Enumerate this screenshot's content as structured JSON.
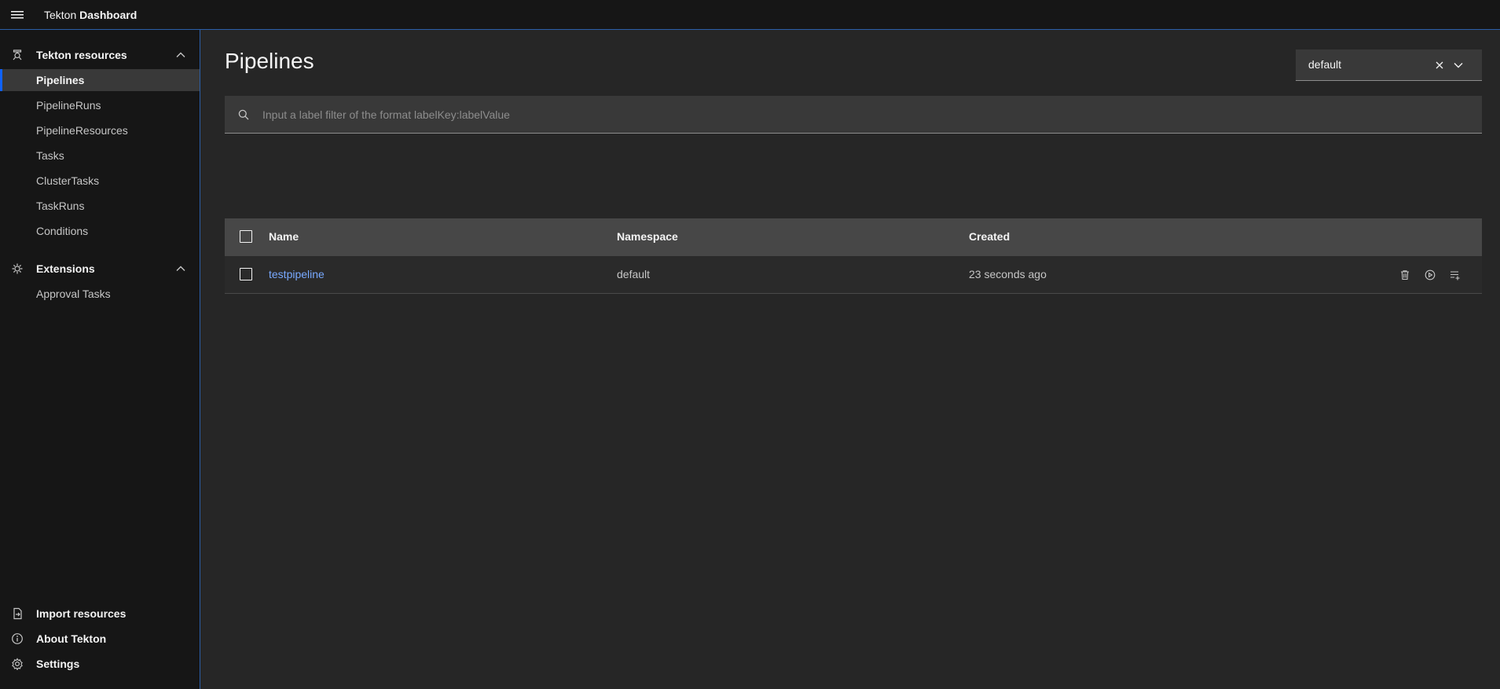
{
  "header": {
    "brand_prefix": "Tekton",
    "brand_bold": "Dashboard"
  },
  "sidebar": {
    "sections": [
      {
        "title": "Tekton resources",
        "items": [
          {
            "label": "Pipelines",
            "active": true
          },
          {
            "label": "PipelineRuns"
          },
          {
            "label": "PipelineResources"
          },
          {
            "label": "Tasks"
          },
          {
            "label": "ClusterTasks"
          },
          {
            "label": "TaskRuns"
          },
          {
            "label": "Conditions"
          }
        ]
      },
      {
        "title": "Extensions",
        "items": [
          {
            "label": "Approval Tasks"
          }
        ]
      }
    ],
    "footer": [
      {
        "label": "Import resources",
        "icon": "import-icon"
      },
      {
        "label": "About Tekton",
        "icon": "info-icon"
      },
      {
        "label": "Settings",
        "icon": "gear-icon"
      }
    ]
  },
  "main": {
    "title": "Pipelines",
    "namespace": {
      "value": "default"
    },
    "filter": {
      "placeholder": "Input a label filter of the format labelKey:labelValue",
      "value": ""
    },
    "table": {
      "columns": [
        "Name",
        "Namespace",
        "Created"
      ],
      "rows": [
        {
          "name": "testpipeline",
          "namespace": "default",
          "created": "23 seconds ago"
        }
      ],
      "row_actions": [
        "delete-icon",
        "play-icon",
        "add-list-icon"
      ]
    }
  },
  "colors": {
    "accent": "#0f62fe",
    "link": "#78a9ff",
    "background": "#262626",
    "sidebar": "#161616"
  }
}
